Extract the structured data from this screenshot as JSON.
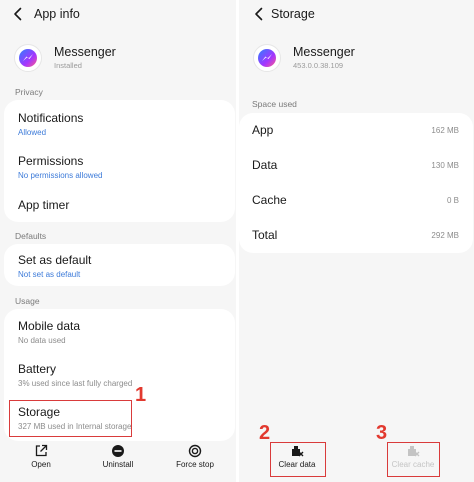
{
  "left_panel": {
    "title": "App info",
    "app": {
      "name": "Messenger",
      "status": "Installed"
    },
    "privacy": {
      "header": "Privacy",
      "items": [
        {
          "title": "Notifications",
          "subtitle": "Allowed"
        },
        {
          "title": "Permissions",
          "subtitle": "No permissions allowed"
        },
        {
          "title": "App timer",
          "subtitle": ""
        }
      ]
    },
    "defaults": {
      "header": "Defaults",
      "items": [
        {
          "title": "Set as default",
          "subtitle": "Not set as default"
        }
      ]
    },
    "usage": {
      "header": "Usage",
      "items": [
        {
          "title": "Mobile data",
          "subtitle": "No data used"
        },
        {
          "title": "Battery",
          "subtitle": "3% used since last fully charged"
        },
        {
          "title": "Storage",
          "subtitle": "327 MB used in Internal storage"
        }
      ]
    },
    "bottom_bar": [
      {
        "label": "Open",
        "icon": "open-external-icon"
      },
      {
        "label": "Uninstall",
        "icon": "minus-circle-icon"
      },
      {
        "label": "Force stop",
        "icon": "stop-circle-icon"
      }
    ]
  },
  "right_panel": {
    "title": "Storage",
    "app": {
      "name": "Messenger",
      "version": "453.0.0.38.109"
    },
    "space_used": {
      "header": "Space used",
      "rows": [
        {
          "label": "App",
          "value": "162 MB"
        },
        {
          "label": "Data",
          "value": "130 MB"
        },
        {
          "label": "Cache",
          "value": "0 B"
        },
        {
          "label": "Total",
          "value": "292 MB"
        }
      ]
    },
    "bottom_bar": [
      {
        "label": "Clear data",
        "icon": "clear-data-icon",
        "enabled": true
      },
      {
        "label": "Clear cache",
        "icon": "clear-cache-icon",
        "enabled": false
      }
    ]
  },
  "annotations": {
    "step1": "1",
    "step2": "2",
    "step3": "3"
  },
  "colors": {
    "annotation_red": "#d93b3b",
    "link_blue": "#3d7bd9",
    "panel_bg": "#f6f6f6"
  }
}
